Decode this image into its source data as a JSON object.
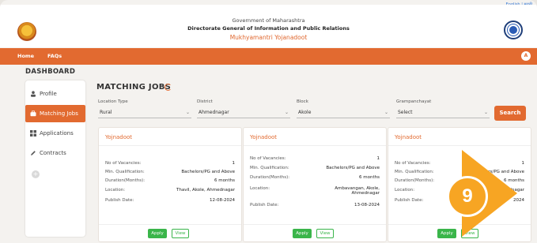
{
  "header": {
    "lang_toggle": "English | मराठी",
    "line1": "Government of Maharashtra",
    "line2": "Directorate General of Information and Public Relations",
    "line3": "Mukhyamantri Yojanadoot"
  },
  "navbar": {
    "items": [
      "Home",
      "FAQs"
    ],
    "user_initial": "A"
  },
  "dashboard_title": "DASHBOARD",
  "sidebar": {
    "items": [
      {
        "label": "Profile",
        "icon": "person-icon"
      },
      {
        "label": "Matching Jobs",
        "icon": "briefcase-icon"
      },
      {
        "label": "Applications",
        "icon": "grid-icon"
      },
      {
        "label": "Contracts",
        "icon": "pen-icon"
      }
    ],
    "add": "+"
  },
  "main": {
    "title": "MATCHING JOBS",
    "filters": {
      "location_type": {
        "label": "Location Type",
        "value": "Rural"
      },
      "district": {
        "label": "District",
        "value": "Ahmednagar"
      },
      "block": {
        "label": "Block",
        "value": "Akole"
      },
      "grampanchayat": {
        "label": "Grampanchayat",
        "value": "Select"
      }
    },
    "search_label": "Search"
  },
  "cards": [
    {
      "title": "Yojnadoot",
      "rows": [
        {
          "k": "No of Vacancies:",
          "v": "1"
        },
        {
          "k": "Min. Qualification:",
          "v": "Bachelors/PG and Above"
        },
        {
          "k": "Duration(Months):",
          "v": "6 months"
        },
        {
          "k": "Location:",
          "v": "Thavil, Akole, Ahmednagar"
        },
        {
          "k": "Publish Date:",
          "v": "12-08-2024"
        }
      ],
      "apply": "Apply",
      "view": "View"
    },
    {
      "title": "Yojnadoot",
      "rows": [
        {
          "k": "No of Vacancies:",
          "v": "1"
        },
        {
          "k": "Min. Qualification:",
          "v": "Bachelors/PG and Above"
        },
        {
          "k": "Duration(Months):",
          "v": "6 months"
        },
        {
          "k": "Location:",
          "v": "Ambavangan, Akole, Ahmednagar"
        },
        {
          "k": "Publish Date:",
          "v": "13-08-2024"
        }
      ],
      "apply": "Apply",
      "view": "View"
    },
    {
      "title": "Yojnadoot",
      "rows": [
        {
          "k": "No of Vacancies:",
          "v": "1"
        },
        {
          "k": "Min. Qualification:",
          "v": "Bachelors/PG and Above"
        },
        {
          "k": "Duration(Months):",
          "v": "6 months"
        },
        {
          "k": "Location:",
          "v": "Ahmednagar"
        },
        {
          "k": "Publish Date:",
          "v": "2024"
        }
      ],
      "apply": "Apply",
      "view": "View"
    }
  ],
  "step_badge": "9",
  "colors": {
    "accent": "#e26a30",
    "apply": "#3ab54a",
    "badge": "#f7a523"
  }
}
